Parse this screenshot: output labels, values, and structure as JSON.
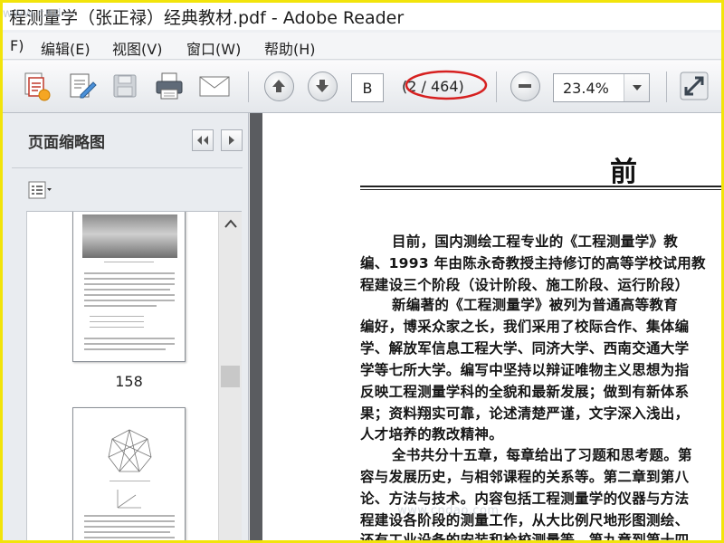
{
  "window": {
    "title": "程测量学（张正禄）经典教材.pdf - Adobe Reader",
    "overlay_watermark": "www.cnd"
  },
  "menu": {
    "items": [
      {
        "label": "F)",
        "name": "menu-file"
      },
      {
        "label": "编辑(E)",
        "name": "menu-edit"
      },
      {
        "label": "视图(V)",
        "name": "menu-view"
      },
      {
        "label": "窗口(W)",
        "name": "menu-window"
      },
      {
        "label": "帮助(H)",
        "name": "menu-help"
      }
    ]
  },
  "toolbar": {
    "icons": [
      "create-pdf-icon",
      "edit-document-icon",
      "save-icon",
      "print-icon",
      "email-icon",
      "previous-page-icon",
      "next-page-icon",
      "zoom-out-icon",
      "chevron-down-icon",
      "fit-page-icon"
    ],
    "page_input": "B",
    "page_count": "(2 / 464)",
    "zoom_value": "23.4%",
    "highlight_color": "#d62020"
  },
  "sidebar": {
    "title": "页面缩略图",
    "thumbnails": [
      {
        "label": "158"
      },
      {
        "label": ""
      }
    ]
  },
  "document": {
    "heading": "前 言",
    "lines": [
      {
        "text": "目前，国内测绘工程专业的《工程测量学》教",
        "indent": true
      },
      {
        "text": "编、1993 年由陈永奇教授主持修订的高等学校试用教",
        "indent": false
      },
      {
        "text": "程建设三个阶段（设计阶段、施工阶段、运行阶段）",
        "indent": false
      },
      {
        "text": "新编著的《工程测量学》被列为普通高等教育",
        "indent": true
      },
      {
        "text": "编好，博采众家之长，我们采用了校际合作、集体编",
        "indent": false
      },
      {
        "text": "学、解放军信息工程大学、同济大学、西南交通大学",
        "indent": false
      },
      {
        "text": "学等七所大学。编写中坚持以辩证唯物主义思想为指",
        "indent": false
      },
      {
        "text": "反映工程测量学科的全貌和最新发展；做到有新体系",
        "indent": false
      },
      {
        "text": "果；资料翔实可靠，论述清楚严谨，文字深入浅出，",
        "indent": false
      },
      {
        "text": "人才培养的教改精神。",
        "indent": false
      },
      {
        "text": "全书共分十五章，每章给出了习题和思考题。第",
        "indent": true
      },
      {
        "text": "容与发展历史，与相邻课程的关系等。第二章到第八",
        "indent": false
      },
      {
        "text": "论、方法与技术。内容包括工程测量学的仪器与方法",
        "indent": false
      },
      {
        "text": "程建设各阶段的测量工作，从大比例尺地形图测绘、",
        "indent": false
      },
      {
        "text": "还有工业设备的安装和检校测量等。第九章到第十四",
        "indent": false
      }
    ],
    "watermark": "www.cndao.com"
  }
}
